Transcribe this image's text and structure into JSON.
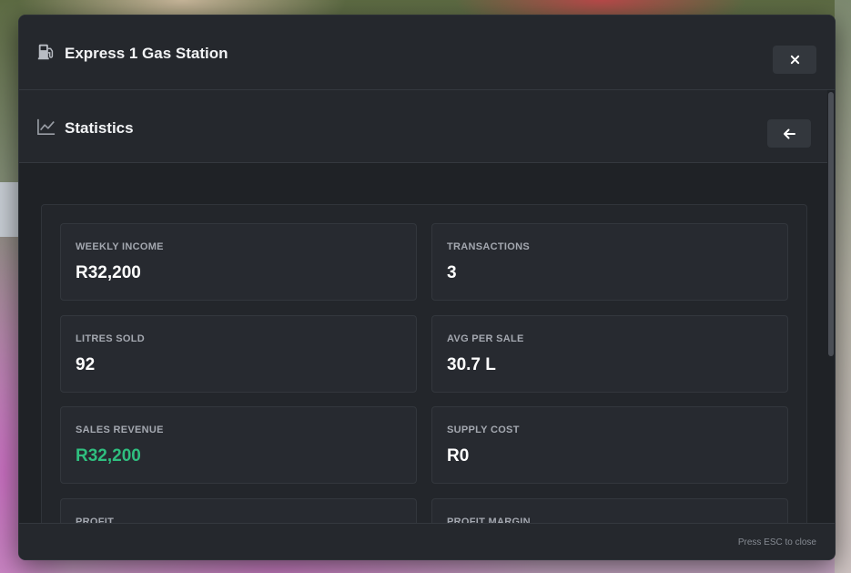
{
  "modal": {
    "title": "Express 1 Gas Station",
    "icons": {
      "title": "fuel-pump-icon",
      "close": "close-icon"
    }
  },
  "section": {
    "title": "Statistics",
    "icons": {
      "title": "line-chart-icon",
      "back": "arrow-left-icon"
    }
  },
  "stats": [
    {
      "label": "WEEKLY INCOME",
      "value": "R32,200"
    },
    {
      "label": "TRANSACTIONS",
      "value": "3"
    },
    {
      "label": "LITRES SOLD",
      "value": "92"
    },
    {
      "label": "AVG PER SALE",
      "value": "30.7 L"
    },
    {
      "label": "SALES REVENUE",
      "value": "R32,200",
      "color": "#2fbf7f"
    },
    {
      "label": "SUPPLY COST",
      "value": "R0"
    },
    {
      "label": "PROFIT",
      "value": ""
    },
    {
      "label": "PROFIT MARGIN",
      "value": ""
    }
  ],
  "footer": {
    "hint": "Press ESC to close"
  }
}
